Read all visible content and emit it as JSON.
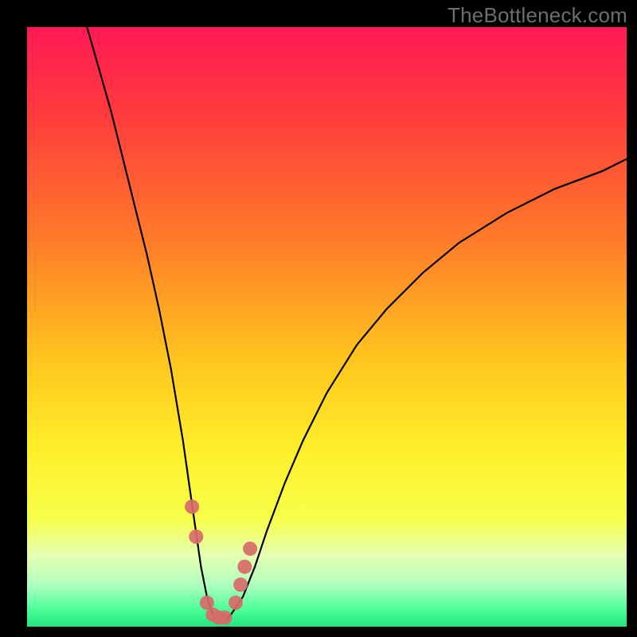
{
  "watermark": "TheBottleneck.com",
  "colors": {
    "frame_bg": "#000000",
    "gradient_stops": [
      {
        "pos": 0,
        "color": "#ff1a55"
      },
      {
        "pos": 15,
        "color": "#ff3c3c"
      },
      {
        "pos": 35,
        "color": "#ff7a2a"
      },
      {
        "pos": 55,
        "color": "#ffc31e"
      },
      {
        "pos": 70,
        "color": "#ffee2a"
      },
      {
        "pos": 82,
        "color": "#f7ff4a"
      },
      {
        "pos": 88,
        "color": "#e6ffb0"
      },
      {
        "pos": 93,
        "color": "#b0ffc0"
      },
      {
        "pos": 97,
        "color": "#4fff9a"
      },
      {
        "pos": 100,
        "color": "#21e57b"
      }
    ],
    "green_band": "#26e07e",
    "pale_band": "#e6ffcc",
    "curve": "#000000",
    "marker_fill": "#d86a6a"
  },
  "chart_data": {
    "type": "line",
    "title": "",
    "xlabel": "",
    "ylabel": "",
    "xlim": [
      0,
      100
    ],
    "ylim": [
      0,
      100
    ],
    "series": [
      {
        "name": "bottleneck-curve",
        "x": [
          10,
          12,
          14,
          16,
          18,
          20,
          22,
          24,
          26,
          27,
          28,
          29,
          30,
          31,
          32,
          33,
          34,
          36,
          38,
          40,
          43,
          46,
          50,
          55,
          60,
          66,
          72,
          80,
          88,
          96,
          100
        ],
        "y": [
          100,
          93,
          86,
          78,
          70,
          62,
          53,
          43,
          31,
          24,
          17,
          10,
          5,
          2,
          1,
          1,
          2,
          5,
          10,
          16,
          24,
          31,
          39,
          47,
          53,
          59,
          64,
          69,
          73,
          76,
          78
        ]
      }
    ],
    "markers": {
      "name": "highlight-points",
      "x": [
        27.5,
        28.2,
        30.0,
        31.0,
        32.0,
        33.0,
        34.8,
        35.6,
        36.3,
        37.2
      ],
      "y": [
        20,
        15,
        4,
        2,
        1.5,
        1.5,
        4,
        7,
        10,
        13
      ],
      "r": 9
    },
    "bands": [
      {
        "name": "pale-yellow-band",
        "y_from": 80.8,
        "y_to": 92
      },
      {
        "name": "green-band",
        "y_from": 97.6,
        "y_to": 100
      }
    ]
  }
}
